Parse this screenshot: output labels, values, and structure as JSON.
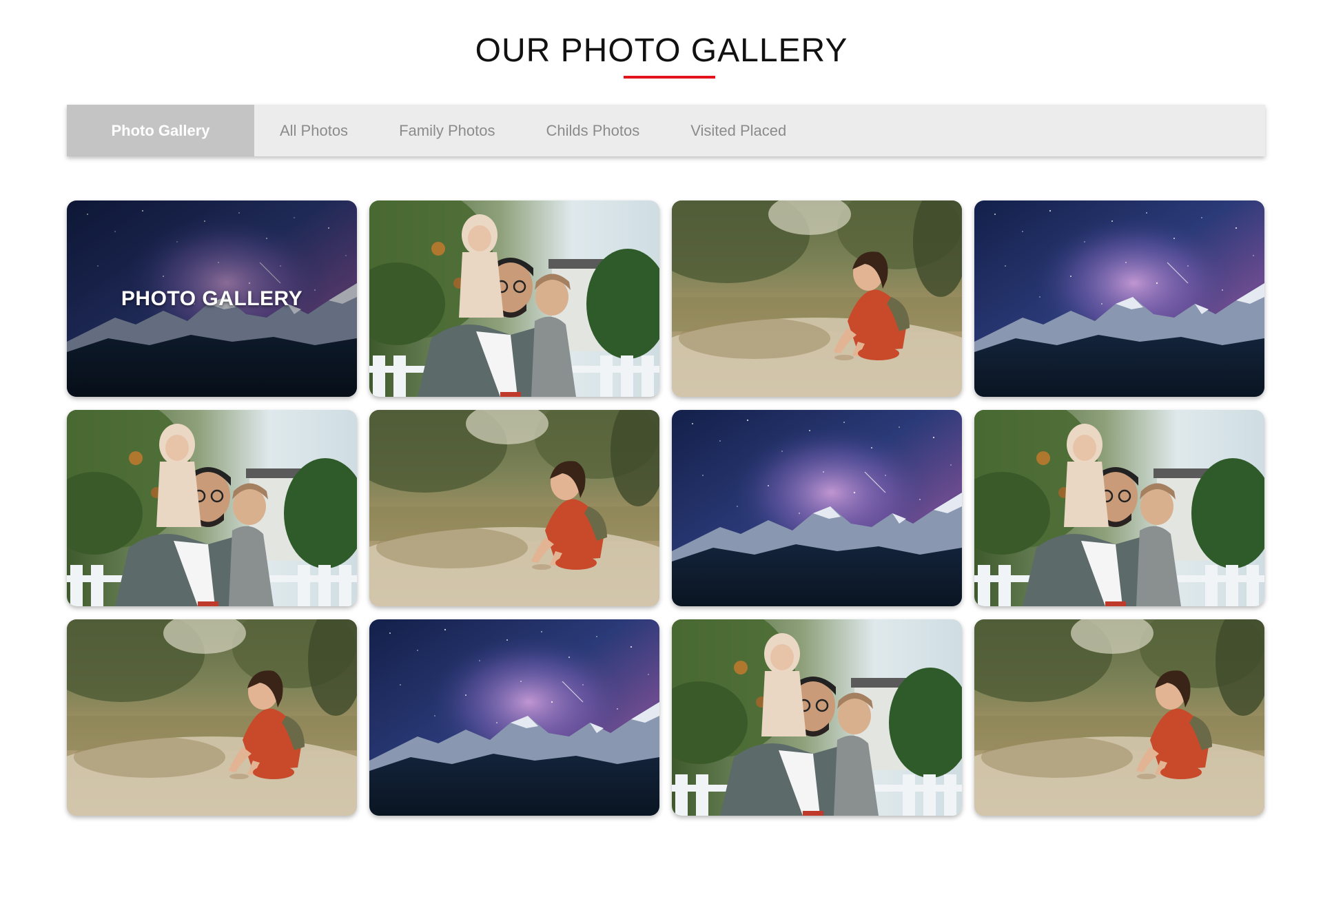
{
  "page_title": "OUR PHOTO GALLERY",
  "colors": {
    "accent": "#e3141b",
    "tabbar_bg": "#ececec",
    "tab_active_bg": "#c4c4c4",
    "tab_text": "#8b8b8b"
  },
  "tabs": [
    {
      "label": "Photo Gallery",
      "active": true
    },
    {
      "label": "All Photos",
      "active": false
    },
    {
      "label": "Family Photos",
      "active": false
    },
    {
      "label": "Childs Photos",
      "active": false
    },
    {
      "label": "Visited Placed",
      "active": false
    }
  ],
  "gallery": {
    "caption": "PHOTO GALLERY",
    "tiles": [
      {
        "scene": "night-sky-mountains",
        "caption": true
      },
      {
        "scene": "family-father-children"
      },
      {
        "scene": "girl-playing-in-field"
      },
      {
        "scene": "night-sky-mountains"
      },
      {
        "scene": "family-father-children"
      },
      {
        "scene": "girl-playing-in-field"
      },
      {
        "scene": "night-sky-mountains"
      },
      {
        "scene": "family-father-children"
      },
      {
        "scene": "girl-playing-in-field"
      },
      {
        "scene": "night-sky-mountains"
      },
      {
        "scene": "family-father-children"
      },
      {
        "scene": "girl-playing-in-field"
      }
    ]
  }
}
